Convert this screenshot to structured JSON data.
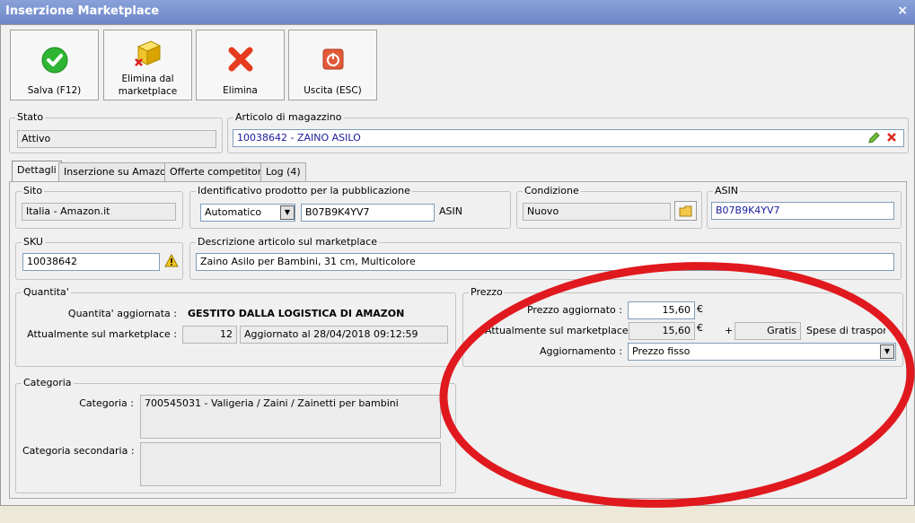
{
  "window": {
    "title": "Inserzione Marketplace",
    "close": "×"
  },
  "toolbar": {
    "save": "Salva (F12)",
    "remove_line1": "Elimina dal",
    "remove_line2": "marketplace",
    "delete": "Elimina",
    "exit": "Uscita (ESC)"
  },
  "stato": {
    "title": "Stato",
    "value": "Attivo"
  },
  "articolo": {
    "title": "Articolo di magazzino",
    "value": "10038642 - ZAINO ASILO"
  },
  "tabs": [
    "Dettagli",
    "Inserzione su Amazon",
    "Offerte competitors",
    "Log (4)"
  ],
  "sito": {
    "title": "Sito",
    "value": "Italia - Amazon.it"
  },
  "identificativo": {
    "title": "Identificativo prodotto per la pubblicazione",
    "type": "Automatico",
    "code": "B07B9K4YV7",
    "suffix": "ASIN"
  },
  "condizione": {
    "title": "Condizione",
    "value": "Nuovo"
  },
  "asin": {
    "title": "ASIN",
    "value": "B07B9K4YV7"
  },
  "sku": {
    "title": "SKU",
    "value": "10038642"
  },
  "descrizione": {
    "title": "Descrizione articolo sul marketplace",
    "value": "Zaino Asilo per Bambini, 31 cm, Multicolore"
  },
  "quantita": {
    "title": "Quantita'",
    "aggiornata_label": "Quantita' aggiornata :",
    "aggiornata_value": "GESTITO DALLA LOGISTICA DI AMAZON",
    "attuale_label": "Attualmente sul marketplace :",
    "attuale_value": "12",
    "aggiornato_al": "Aggiornato al 28/04/2018 09:12:59"
  },
  "prezzo": {
    "title": "Prezzo",
    "aggiornato_label": "Prezzo aggiornato :",
    "aggiornato_value": "15,60",
    "currency": "€",
    "attuale_label": "Attualmente sul marketplace :",
    "attuale_value": "15,60",
    "plus": "+",
    "spedizione_value": "Gratis",
    "spedizione_label": "Spese di trasporto",
    "aggiornamento_label": "Aggiornamento :",
    "aggiornamento_value": "Prezzo fisso"
  },
  "categoria": {
    "title": "Categoria",
    "cat_label": "Categoria :",
    "cat_value": "700545031 - Valigeria / Zaini / Zainetti per bambini",
    "sec_label": "Categoria secondaria :",
    "sec_value": ""
  },
  "colors": {
    "annotation": "#e0191e",
    "title_bar": "#7a90cc",
    "blue_text": "#1a1a9c"
  }
}
